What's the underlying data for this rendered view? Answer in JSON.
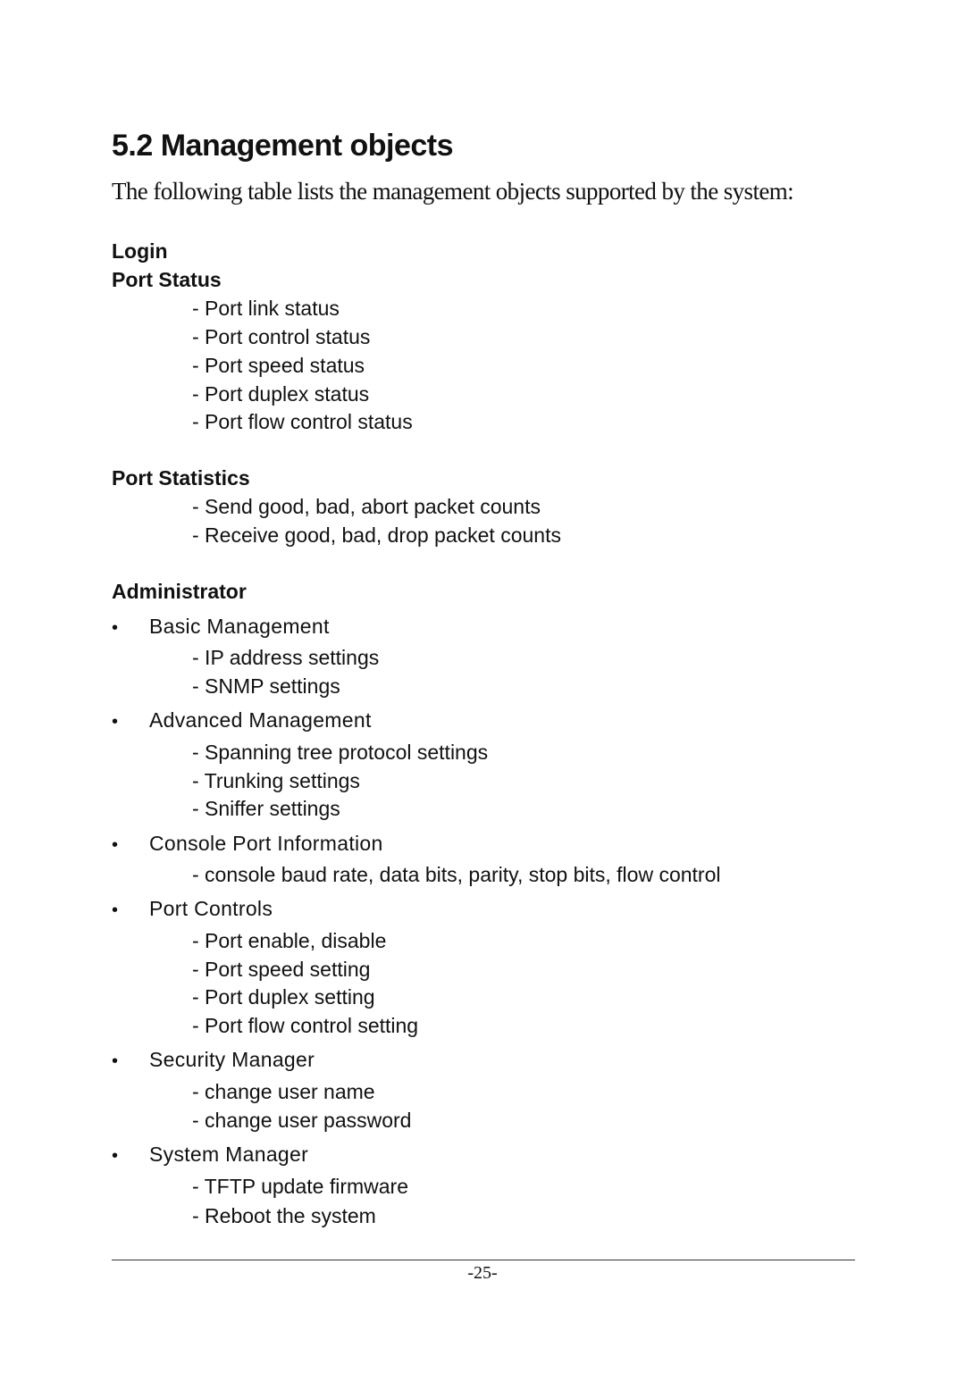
{
  "document": {
    "section_title": "5.2 Management objects",
    "intro": "The following table lists the management objects supported by the system:",
    "login": {
      "heading": "Login"
    },
    "port_status": {
      "heading": "Port Status",
      "items": [
        "- Port link status",
        "- Port control status",
        "- Port speed status",
        "- Port duplex status",
        "- Port flow control status"
      ]
    },
    "port_statistics": {
      "heading": "Port Statistics",
      "items": [
        "- Send good, bad, abort packet counts",
        "- Receive good, bad, drop packet counts"
      ]
    },
    "administrator": {
      "heading": "Administrator",
      "bullet_glyph": "•",
      "groups": [
        {
          "label": "Basic Management",
          "items": [
            "- IP address settings",
            "- SNMP settings"
          ]
        },
        {
          "label": "Advanced Management",
          "items": [
            "- Spanning tree protocol settings",
            "- Trunking settings",
            "- Sniffer settings"
          ]
        },
        {
          "label": "Console Port Information",
          "items": [
            "- console baud rate, data bits, parity, stop bits, flow control"
          ]
        },
        {
          "label": "Port Controls",
          "items": [
            "- Port enable, disable",
            "- Port speed setting",
            "- Port duplex setting",
            "- Port flow control setting"
          ]
        },
        {
          "label": "Security Manager",
          "items": [
            "- change user name",
            "- change user password"
          ]
        },
        {
          "label": "System Manager",
          "items": [
            "- TFTP update firmware",
            "- Reboot the system"
          ]
        }
      ]
    },
    "footer": {
      "page_number": "-25-"
    }
  }
}
